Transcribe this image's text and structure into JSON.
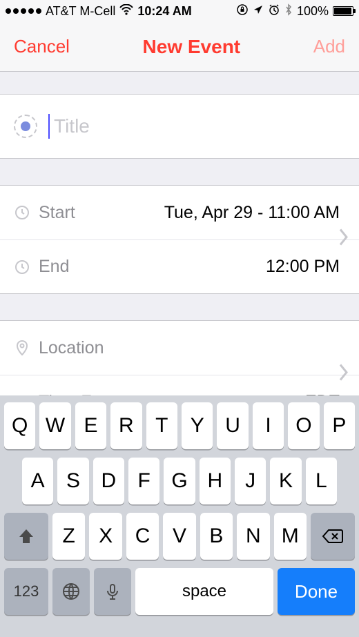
{
  "statusBar": {
    "carrier": "AT&T M-Cell",
    "time": "10:24 AM",
    "batteryPercent": "100%"
  },
  "nav": {
    "cancel": "Cancel",
    "title": "New Event",
    "add": "Add"
  },
  "titleField": {
    "placeholder": "Title",
    "value": ""
  },
  "dates": {
    "startLabel": "Start",
    "startValue": "Tue, Apr 29 - 11:00 AM",
    "endLabel": "End",
    "endValue": "12:00 PM"
  },
  "location": {
    "locationLabel": "Location",
    "locationValue": "",
    "timezoneLabel": "Time Zone",
    "timezoneValue": "EDT"
  },
  "keyboard": {
    "row1": [
      "Q",
      "W",
      "E",
      "R",
      "T",
      "Y",
      "U",
      "I",
      "O",
      "P"
    ],
    "row2": [
      "A",
      "S",
      "D",
      "F",
      "G",
      "H",
      "J",
      "K",
      "L"
    ],
    "row3": [
      "Z",
      "X",
      "C",
      "V",
      "B",
      "N",
      "M"
    ],
    "numbersKey": "123",
    "spaceKey": "space",
    "doneKey": "Done"
  }
}
